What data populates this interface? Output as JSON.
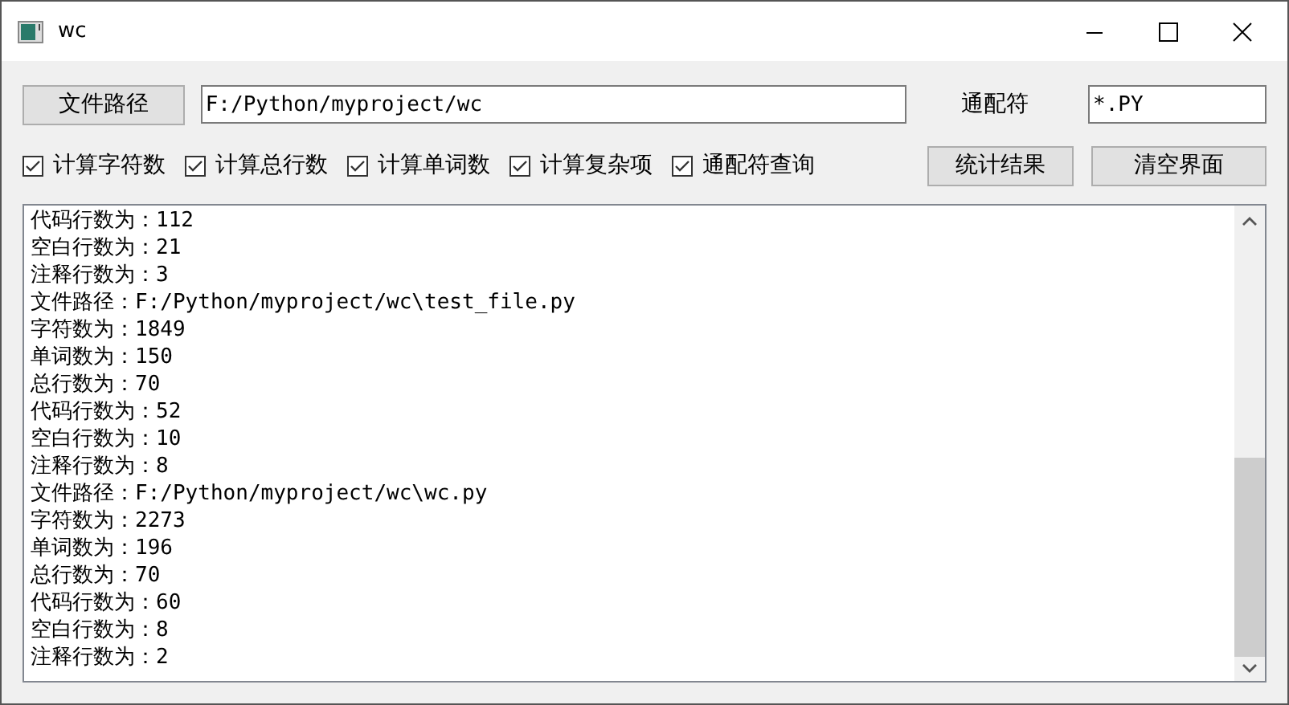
{
  "window": {
    "title": "wc"
  },
  "path_button": "文件路径",
  "path_field": {
    "value": "F:/Python/myproject/wc"
  },
  "wildcard_label": "通配符",
  "wildcard_field": {
    "value": "*.PY"
  },
  "options": [
    {
      "label": "计算字符数",
      "checked": true
    },
    {
      "label": "计算总行数",
      "checked": true
    },
    {
      "label": "计算单词数",
      "checked": true
    },
    {
      "label": "计算复杂项",
      "checked": true
    },
    {
      "label": "通配符查询",
      "checked": true
    }
  ],
  "buttons": [
    "统计结果",
    "清空界面"
  ],
  "output": [
    "代码行数为：112",
    "空白行数为：21",
    "注释行数为：3",
    "文件路径：F:/Python/myproject/wc\\test_file.py",
    "字符数为：1849",
    "单词数为：150",
    "总行数为：70",
    "代码行数为：52",
    "空白行数为：10",
    "注释行数为：8",
    "文件路径：F:/Python/myproject/wc\\wc.py",
    "字符数为：2273",
    "单词数为：196",
    "总行数为：70",
    "代码行数为：60",
    "空白行数为：8",
    "注释行数为：2"
  ]
}
